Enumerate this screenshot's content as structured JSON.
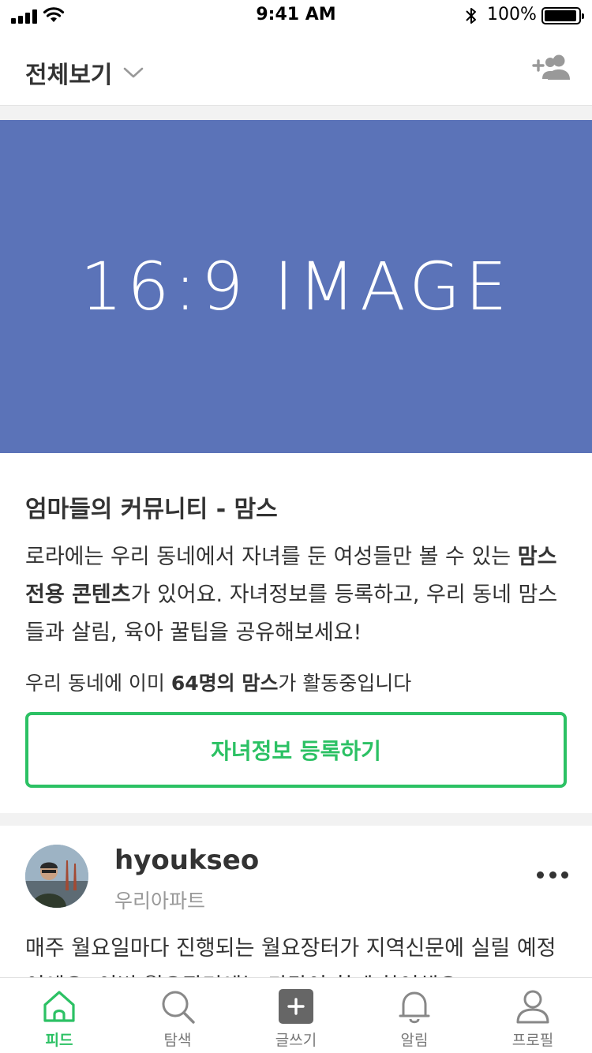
{
  "status_bar": {
    "time": "9:41 AM",
    "battery": "100%"
  },
  "header": {
    "title": "전체보기",
    "add_friend_icon": "add-user-icon"
  },
  "hero": {
    "text": "16:9 IMAGE",
    "color": "#5b73b8"
  },
  "intro": {
    "title": "엄마들의 커뮤니티 - 맘스",
    "desc_1": "로라에는 우리 동네에서 자녀를 둔 여성들만 볼 수 있는 ",
    "desc_bold": "맘스 전용 콘텐츠",
    "desc_2": "가 있어요. 자녀정보를 등록하고, 우리 동네 맘스들과 살림, 육아 꿀팁을 공유해보세요!",
    "count_1": "우리 동네에 이미 ",
    "count_bold": "64명의 맘스",
    "count_2": "가 활동중입니다",
    "button_label": "자녀정보 등록하기",
    "accent": "#2cc164"
  },
  "post": {
    "username": "hyoukseo",
    "location": "우리아파트",
    "body": "매주 월요일마다 진행되는 월요장터가 지역신문에 실릴 예정이에요. 이번 월요장터에는 다같이 함께 참여해요"
  },
  "tabbar": {
    "tabs": [
      {
        "label": "피드",
        "icon": "home-icon",
        "active": true
      },
      {
        "label": "탐색",
        "icon": "search-icon",
        "active": false
      },
      {
        "label": "글쓰기",
        "icon": "plus-icon",
        "active": false
      },
      {
        "label": "알림",
        "icon": "bell-icon",
        "active": false
      },
      {
        "label": "프로필",
        "icon": "profile-icon",
        "active": false
      }
    ]
  }
}
